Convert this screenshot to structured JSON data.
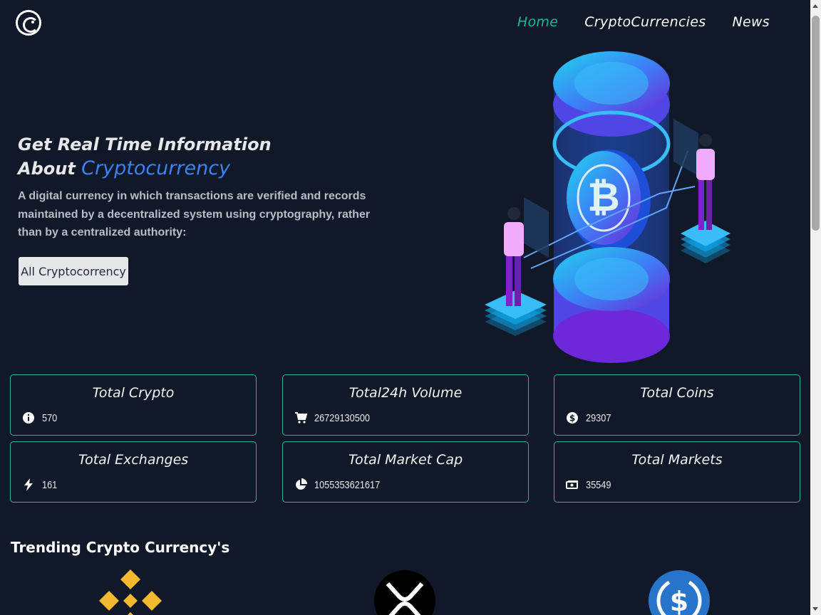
{
  "nav": {
    "items": [
      {
        "label": "Home",
        "active": true
      },
      {
        "label": "CryptoCurrencies",
        "active": false
      },
      {
        "label": "News",
        "active": false
      }
    ]
  },
  "hero": {
    "title_line1": "Get Real Time Information",
    "title_line2_prefix": "About ",
    "title_line2_accent": "Cryptocurrency",
    "description": "A digital currency in which transactions are verified and records maintained by a decentralized system using cryptography, rather than by a centralized authority:",
    "button_label": "All Cryptocorrency"
  },
  "stats": [
    {
      "title": "Total Crypto",
      "value": "570",
      "icon": "info-icon"
    },
    {
      "title": "Total24h Volume",
      "value": "26729130500",
      "icon": "cart-icon"
    },
    {
      "title": "Total Coins",
      "value": "29307",
      "icon": "dollar-circle-icon"
    },
    {
      "title": "Total Exchanges",
      "value": "161",
      "icon": "bolt-icon"
    },
    {
      "title": "Total Market Cap",
      "value": "1055353621617",
      "icon": "pie-chart-icon"
    },
    {
      "title": "Total Markets",
      "value": "35549",
      "icon": "money-icon"
    }
  ],
  "trending": {
    "title": "Trending Crypto Currency's",
    "coins": [
      "binance-coin-icon",
      "xrp-icon",
      "usdc-icon"
    ]
  },
  "colors": {
    "background": "#111827",
    "accent_teal": "#14b8a6",
    "accent_blue": "#3b82f6",
    "card_border": "#2ab3a3"
  }
}
